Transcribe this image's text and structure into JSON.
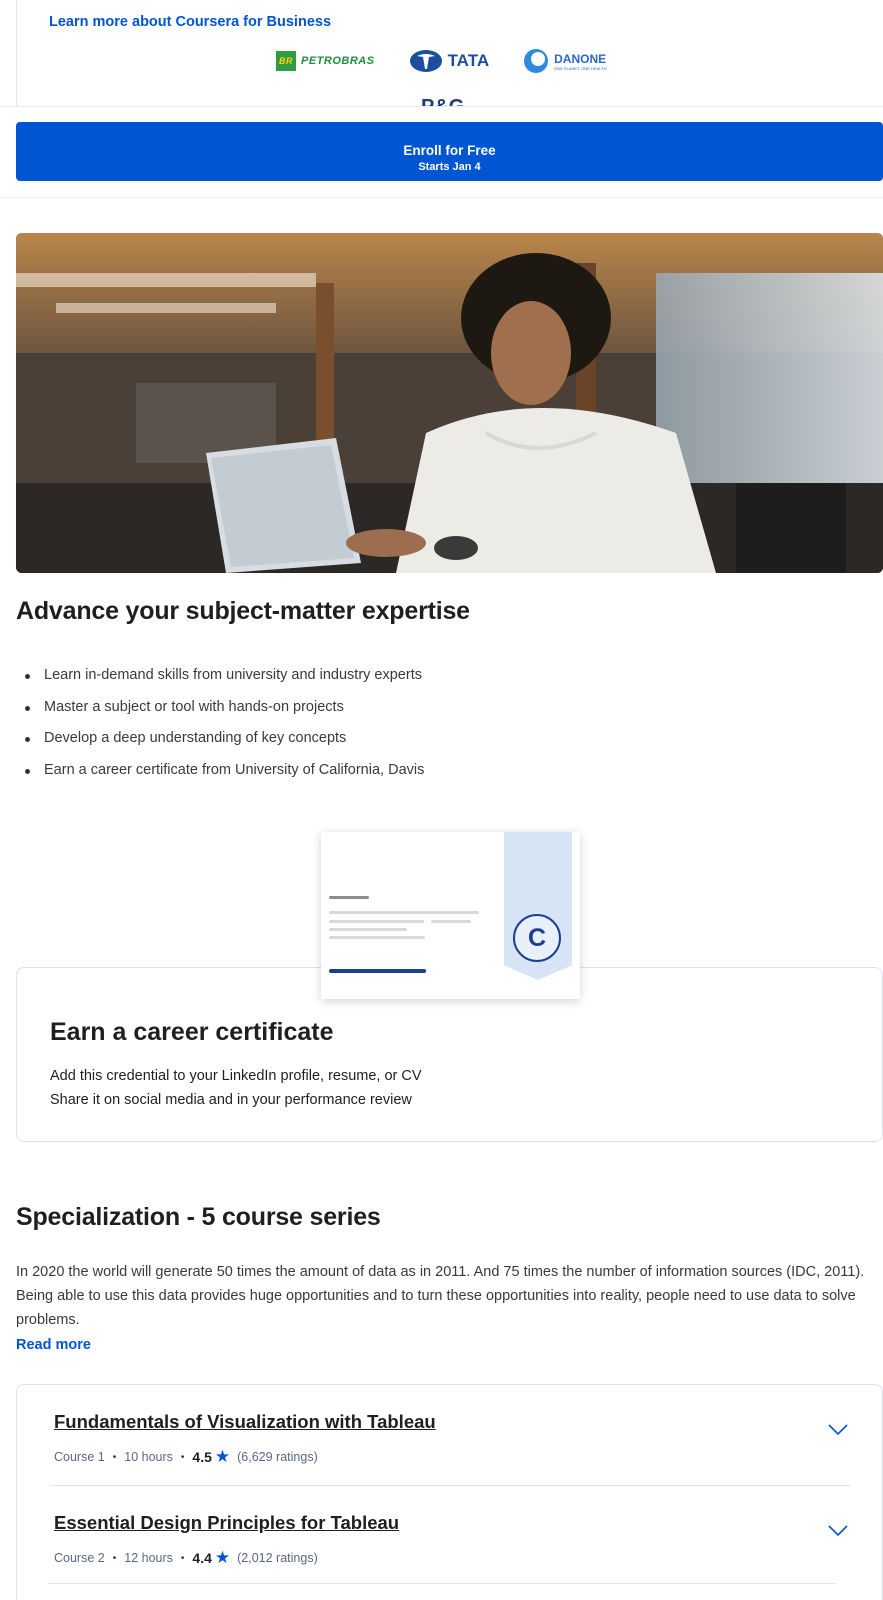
{
  "business": {
    "learn_more_link": "Learn more about Coursera for Business",
    "logos": [
      "PETROBRAS",
      "TATA",
      "DANONE"
    ],
    "petrobras_mark": "BR",
    "danone_tagline": "ONE PLANET. ONE HEALTH",
    "partial_logo": "P&G"
  },
  "enroll": {
    "label": "Enroll for Free",
    "sub_label": "Starts Jan 4",
    "color": "#0056d2"
  },
  "expertise": {
    "heading": "Advance your subject-matter expertise",
    "bullets": [
      "Learn in-demand skills from university and industry experts",
      "Master a subject or tool with hands-on projects",
      "Develop a deep understanding of key concepts",
      "Earn a career certificate from University of California, Davis"
    ]
  },
  "certificate": {
    "heading": "Earn a career certificate",
    "lines": [
      "Add this credential to your LinkedIn profile, resume, or CV",
      "Share it on social media and in your performance review"
    ],
    "seal_letter": "C"
  },
  "specialization": {
    "heading": "Specialization - 5 course series",
    "description": "In 2020 the world will generate 50 times the amount of data as in 2011. And 75 times the number of information sources (IDC, 2011). Being able to use this data provides huge opportunities and to turn these opportunities into reality, people need to use data to solve problems.",
    "read_more": "Read more",
    "courses": [
      {
        "title": "Fundamentals of Visualization with Tableau",
        "course_no": "Course 1",
        "hours": "10 hours",
        "rating": "4.5",
        "ratings_count": "(6,629 ratings)"
      },
      {
        "title": "Essential Design Principles for Tableau",
        "course_no": "Course 2",
        "hours": "12 hours",
        "rating": "4.4",
        "ratings_count": "(2,012 ratings)"
      }
    ]
  },
  "icons": {
    "star": "star-icon",
    "chevron": "chevron-down-icon"
  }
}
